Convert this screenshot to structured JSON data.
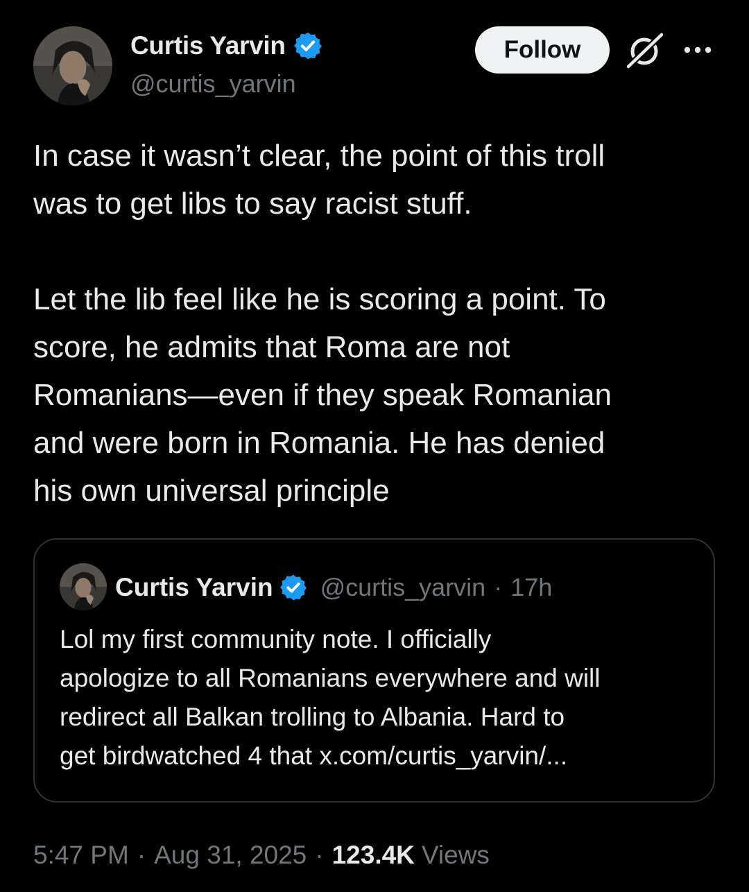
{
  "author": {
    "display_name": "Curtis Yarvin",
    "handle": "@curtis_yarvin",
    "verified_icon": "verified-badge-icon",
    "badge_color": "#1d9bf0"
  },
  "actions": {
    "follow_label": "Follow",
    "grok_icon": "grok-icon",
    "more_icon": "more-options-icon"
  },
  "tweet": {
    "lines": [
      "In case it wasn’t clear, the point of this troll",
      "was to get libs to say racist stuff.",
      "",
      "Let the lib feel like he is scoring a point. To",
      "score, he admits that Roma are not",
      "Romanians—even if they speak Romanian",
      "and were born in Romania.  He has denied",
      "his own universal principle"
    ]
  },
  "quoted": {
    "display_name": "Curtis Yarvin",
    "handle": "@curtis_yarvin",
    "separator": "·",
    "time": "17h",
    "lines": [
      "Lol my first community note. I officially",
      "apologize to all Romanians everywhere and will",
      "redirect all Balkan trolling to Albania. Hard to",
      "get birdwatched 4 that x.com/curtis_yarvin/..."
    ]
  },
  "meta": {
    "time": "5:47 PM",
    "separator": "·",
    "date": "Aug 31, 2025",
    "views_count": "123.4K",
    "views_label": "Views"
  },
  "colors": {
    "background": "#000000",
    "text": "#e7e9ea",
    "secondary": "#71767b",
    "border": "#2f3336",
    "follow_bg": "#eff3f4"
  }
}
